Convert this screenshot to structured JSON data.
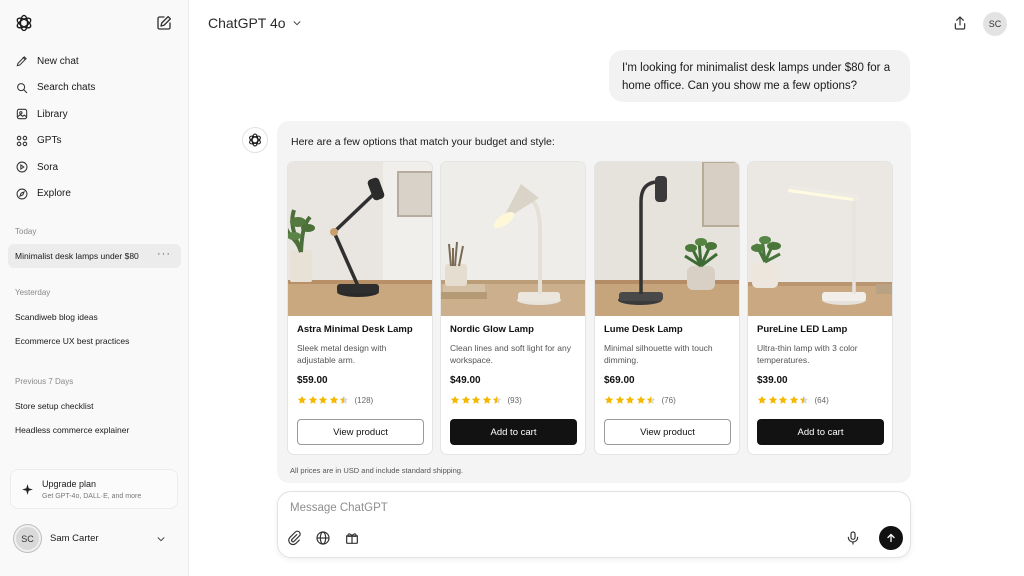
{
  "sidebar": {
    "items": [
      {
        "label": "New chat",
        "icon": "pencil-icon"
      },
      {
        "label": "Search chats",
        "icon": "search-icon"
      },
      {
        "label": "Library",
        "icon": "library-icon"
      },
      {
        "label": "GPTs",
        "icon": "grid-icon"
      },
      {
        "label": "Sora",
        "icon": "play-circle-icon"
      },
      {
        "label": "Explore",
        "icon": "compass-icon"
      }
    ],
    "sections": [
      {
        "label": "Today",
        "chats": [
          "Minimalist desk lamps under $80"
        ]
      },
      {
        "label": "Yesterday",
        "chats": [
          "Scandiweb blog ideas",
          "Ecommerce UX best practices"
        ]
      },
      {
        "label": "Previous 7 Days",
        "chats": [
          "Store setup checklist",
          "Headless commerce explainer"
        ]
      }
    ],
    "active_chat_more": "···",
    "upgrade": {
      "title": "Upgrade plan",
      "subtitle": "Get GPT-4o, DALL·E, and more"
    },
    "user": {
      "initials": "SC",
      "name": "Sam Carter"
    }
  },
  "header": {
    "model": "ChatGPT 4o",
    "avatar_initials": "SC"
  },
  "conversation": {
    "user_message": "I'm looking for minimalist desk lamps under $80 for a home office. Can you show me a few options?",
    "assistant_intro": "Here are a few options that match your budget and style:",
    "assistant_footer": "All prices are in USD and include standard shipping.",
    "products": [
      {
        "name": "Astra Minimal Desk Lamp",
        "desc": "Sleek metal design with adjustable arm.",
        "price": "$59.00",
        "rating": 4.5,
        "reviews": "(128)",
        "button": "View product",
        "button_style": "outline"
      },
      {
        "name": "Nordic Glow Lamp",
        "desc": "Clean lines and soft light for any workspace.",
        "price": "$49.00",
        "rating": 4.5,
        "reviews": "(93)",
        "button": "Add to cart",
        "button_style": "solid"
      },
      {
        "name": "Lume Desk Lamp",
        "desc": "Minimal silhouette with touch dimming.",
        "price": "$69.00",
        "rating": 4.5,
        "reviews": "(76)",
        "button": "View product",
        "button_style": "outline"
      },
      {
        "name": "PureLine LED Lamp",
        "desc": "Ultra-thin lamp with 3 color temperatures.",
        "price": "$39.00",
        "rating": 4.5,
        "reviews": "(64)",
        "button": "Add to cart",
        "button_style": "solid"
      }
    ]
  },
  "composer": {
    "placeholder": "Message ChatGPT",
    "tools": [
      "paperclip-icon",
      "globe-icon",
      "gift-icon"
    ]
  },
  "colors": {
    "sidebar_bg": "#f9f9f9",
    "panel_bg": "#f4f4f4",
    "star": "#f5b800",
    "solid_button": "#121212"
  }
}
